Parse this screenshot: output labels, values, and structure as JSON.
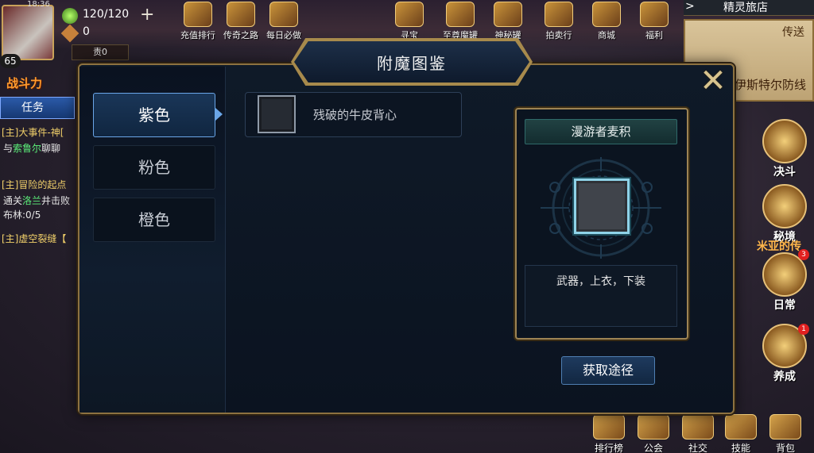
{
  "hud": {
    "time": "18:36",
    "level": "65",
    "stamina": "120/120",
    "coins": "0",
    "rank_label": "责0",
    "combat_power_label": "战斗力",
    "quest_button": "任务",
    "quests": [
      {
        "title": "[主]大事件-神[",
        "detail_prefix": "与",
        "detail_highlight": "索鲁尔",
        "detail_suffix": "聊聊"
      },
      {
        "title": "[主]冒险的起点",
        "detail_prefix": "通关",
        "detail_highlight": "洛兰",
        "detail_suffix": "井击败",
        "detail2": "布林:0/5"
      },
      {
        "title": "[主]虚空裂缝【",
        "detail_prefix": "",
        "detail_highlight": "",
        "detail_suffix": ""
      }
    ],
    "top_icons": [
      {
        "label": "充值排行",
        "icon": "trophy-icon"
      },
      {
        "label": "传奇之路",
        "icon": "road-icon"
      },
      {
        "label": "每日必做",
        "icon": "scroll-icon"
      },
      {
        "label": "寻宝",
        "icon": "map-icon"
      },
      {
        "label": "至尊魔罐",
        "icon": "jar-icon"
      },
      {
        "label": "神秘罐",
        "icon": "mystery-jar-icon"
      },
      {
        "label": "拍卖行",
        "icon": "gavel-icon"
      },
      {
        "label": "商城",
        "icon": "shop-icon"
      },
      {
        "label": "福利",
        "icon": "gift-icon"
      }
    ],
    "right_header": "精灵旅店",
    "map_teleport": "传送",
    "map_location": "伊斯特尔防线",
    "side_icons": [
      {
        "label": "决斗",
        "icon": "duel-icon"
      },
      {
        "label": "秘境",
        "icon": "secret-realm-icon"
      },
      {
        "label": "日常",
        "icon": "daily-icon",
        "badge": "3"
      },
      {
        "label": "养成",
        "icon": "growth-icon",
        "badge": "1"
      }
    ],
    "side_caption": "米亚的传",
    "bottom_icons": [
      {
        "label": "排行榜",
        "icon": "ranking-icon"
      },
      {
        "label": "公会",
        "icon": "guild-icon"
      },
      {
        "label": "社交",
        "icon": "social-icon"
      },
      {
        "label": "技能",
        "icon": "skill-icon"
      },
      {
        "label": "背包",
        "icon": "backpack-icon"
      }
    ]
  },
  "modal": {
    "title": "附魔图鉴",
    "close_icon": "close-icon",
    "tabs": [
      {
        "label": "紫色",
        "active": true
      },
      {
        "label": "粉色",
        "active": false
      },
      {
        "label": "橙色",
        "active": false
      }
    ],
    "items": [
      {
        "name": "残破的牛皮背心"
      }
    ],
    "detail": {
      "title": "漫游者麦积",
      "description": "武器，上衣，下装",
      "acquire_button": "获取途径"
    }
  }
}
